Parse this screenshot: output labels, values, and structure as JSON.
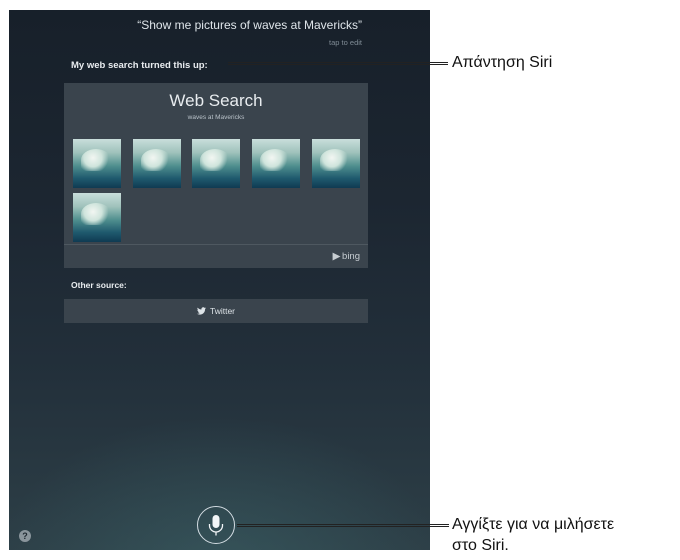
{
  "siri": {
    "query": "“Show me pictures of waves at Mavericks”",
    "tap_to_edit": "tap to edit",
    "response": "My web search turned this up:",
    "card": {
      "title": "Web Search",
      "subtitle": "waves at Mavericks",
      "image_count": 6,
      "provider": "bing"
    },
    "other_source_label": "Other source:",
    "twitter_label": "Twitter",
    "help_glyph": "?"
  },
  "callouts": {
    "response": "Απάντηση Siri",
    "mic_line1": "Αγγίξτε για να μιλήσετε",
    "mic_line2": "στο Siri."
  },
  "colors": {
    "screen_bg": "#1c2631",
    "card_bg": "#3a444d",
    "text": "#e9edf0"
  },
  "icons": [
    "bing-logo-icon",
    "twitter-bird-icon",
    "microphone-icon",
    "help-icon"
  ]
}
